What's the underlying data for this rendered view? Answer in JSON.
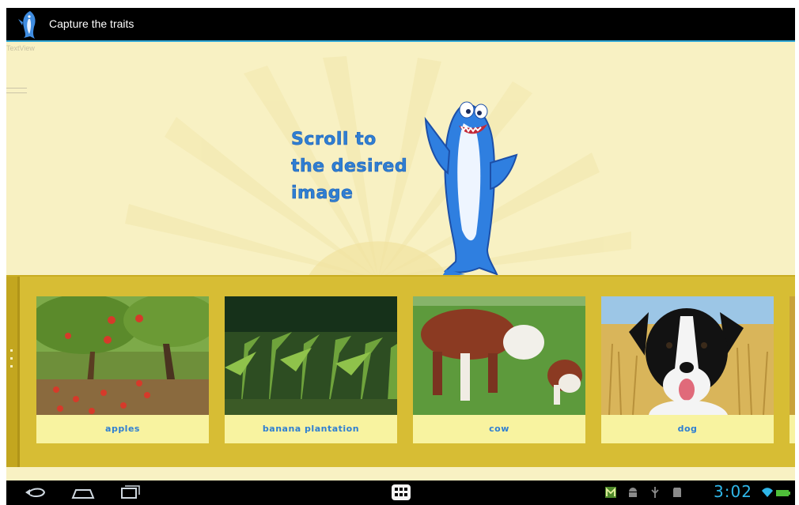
{
  "app": {
    "title": "Capture the traits",
    "logo_icon": "shark-logo-icon"
  },
  "content": {
    "textview_label": "TextView",
    "prompt_lines": [
      "Scroll to",
      "the desired",
      "image"
    ],
    "mascot_icon": "shark-mascot"
  },
  "gallery": {
    "items": [
      {
        "label": "apples"
      },
      {
        "label": "banana plantation"
      },
      {
        "label": "cow"
      },
      {
        "label": "dog"
      }
    ]
  },
  "navbar": {
    "back_icon": "back-icon",
    "home_icon": "home-icon",
    "recents_icon": "recent-apps-icon",
    "apps_icon": "apps-grid-icon"
  },
  "status": {
    "time": "3:02",
    "icons": [
      "notification-m-icon",
      "android-icon",
      "usb-icon",
      "sd-card-icon",
      "wifi-icon",
      "battery-icon"
    ],
    "accent": "#2fb6e8"
  },
  "colors": {
    "background": "#f8f1c3",
    "gallery": "#d7bd34",
    "label_text": "#2f7fd2"
  }
}
